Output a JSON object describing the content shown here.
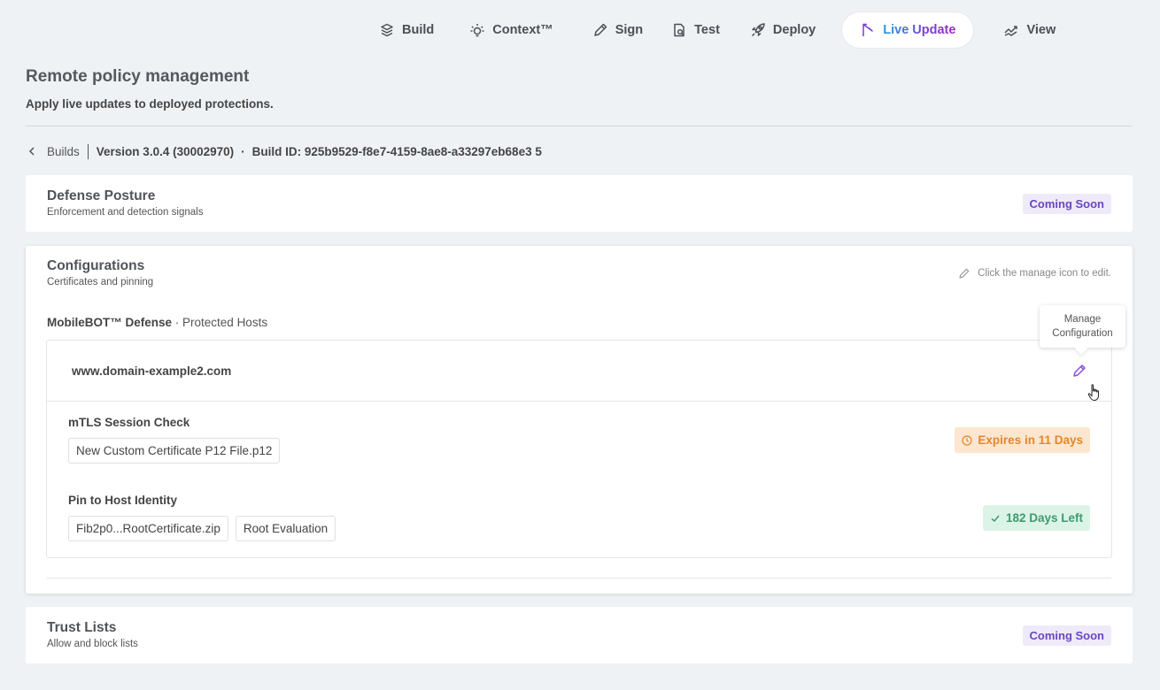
{
  "nav": {
    "items": [
      {
        "label": "Build",
        "icon": "build-icon"
      },
      {
        "label": "Context™",
        "icon": "bulb-icon"
      },
      {
        "label": "Sign",
        "icon": "pen-icon"
      },
      {
        "label": "Test",
        "icon": "test-icon"
      },
      {
        "label": "Deploy",
        "icon": "rocket-icon"
      },
      {
        "label": "Live Update",
        "icon": "live-update-icon",
        "active": true
      },
      {
        "label": "View",
        "icon": "view-icon"
      }
    ]
  },
  "header": {
    "title": "Remote policy management",
    "subtitle": "Apply live updates to deployed protections."
  },
  "breadcrumb": {
    "builds": "Builds",
    "version": "Version 3.0.4 (30002970)",
    "separator": "·",
    "build_id": "Build ID: 925b9529-f8e7-4159-8ae8-a33297eb68e3 5"
  },
  "defense": {
    "title": "Defense Posture",
    "subtitle": "Enforcement and detection signals",
    "badge": "Coming Soon"
  },
  "config": {
    "title": "Configurations",
    "subtitle": "Certificates and pinning",
    "edit_hint": "Click the manage icon to edit.",
    "section_product": "MobileBOT™ Defense",
    "section_rest": " · Protected Hosts",
    "host": "www.domain-example2.com",
    "tooltip_line1": "Manage",
    "tooltip_line2": "Configuration",
    "mtls": {
      "title": "mTLS Session Check",
      "file": "New Custom Certificate P12 File.p12",
      "status": "Expires in 11 Days"
    },
    "pin": {
      "title": "Pin to Host Identity",
      "file": "Fib2p0...RootCertificate.zip",
      "mode": "Root Evaluation",
      "status": "182 Days Left"
    }
  },
  "trust": {
    "title": "Trust Lists",
    "subtitle": "Allow and block lists",
    "badge": "Coming Soon"
  },
  "colors": {
    "accent": "#7a3fd6",
    "warning": "#e5862a",
    "success": "#3f9a6e"
  }
}
